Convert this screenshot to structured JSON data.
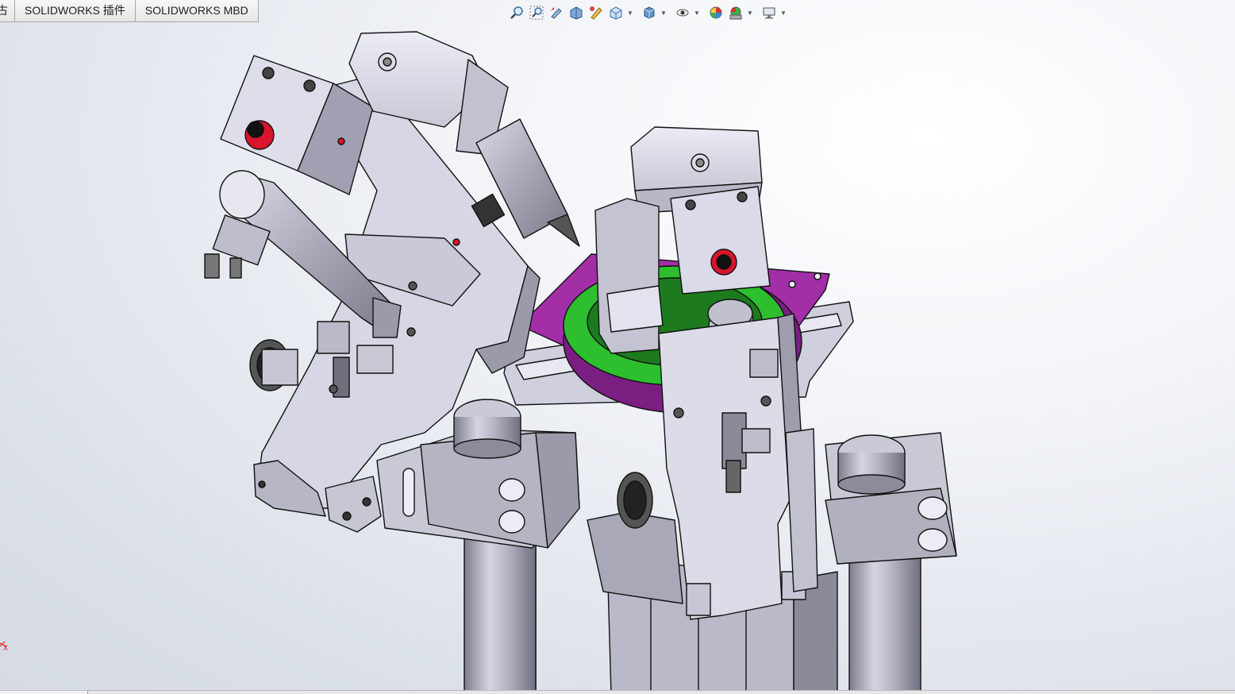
{
  "tabs": [
    {
      "label": "古"
    },
    {
      "label": "SOLIDWORKS 插件"
    },
    {
      "label": "SOLIDWORKS MBD"
    }
  ],
  "hud_icons": [
    "zoom-to-fit-icon",
    "zoom-to-area-icon",
    "previous-view-icon",
    "section-view-icon",
    "dynamic-annotation-icon",
    "view-orientation-icon",
    "display-style-icon",
    "hide-show-items-icon",
    "edit-appearance-icon",
    "apply-scene-icon",
    "view-settings-icon"
  ],
  "colors": {
    "part_gray": "#c7c7d4",
    "part_light": "#e6e6f2",
    "part_dark": "#8d8d9c",
    "plate_magenta": "#a22ea8",
    "green_part": "#2dbf2d",
    "red_fitting": "#d8152a",
    "edge": "#111111"
  },
  "triad_label": "X"
}
